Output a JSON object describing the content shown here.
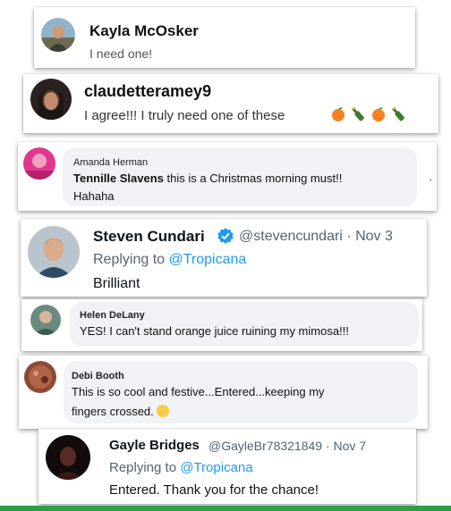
{
  "comments": [
    {
      "name": "Kayla McOsker",
      "text": "I need one!"
    },
    {
      "name": "claudetteramey9",
      "text": "I agree!!! I truly need one of these",
      "emoji": [
        "orange-icon",
        "bottle-icon",
        "orange-icon",
        "bottle-icon"
      ]
    },
    {
      "name": "Amanda Herman",
      "mention": "Tennille Slavens",
      "text": " this is a Christmas morning must!!",
      "text2": "Hahaha",
      "side_glyph": "·"
    },
    {
      "name": "Steven Cundari",
      "handle": "@stevencundari",
      "separator": "·",
      "date": "Nov 3",
      "replying_prefix": "Replying to",
      "replying_to": "@Tropicana",
      "text": "Brilliant"
    },
    {
      "name": "Helen DeLany",
      "text": "YES! I can't stand orange juice ruining my mimosa!!!"
    },
    {
      "name": "Debi Booth",
      "text": "This is so cool and festive...Entered...keeping my",
      "text2": "fingers crossed.",
      "emoji": "😀"
    },
    {
      "name": "Gayle Bridges",
      "handle": "@GayleBr78321849",
      "separator": "·",
      "date": "Nov 7",
      "replying_prefix": "Replying to",
      "replying_to": "@Tropicana",
      "text": "Entered. Thank you for the chance!"
    }
  ],
  "colors": {
    "twitter_blue": "#1d9bf0",
    "bubble_gray": "#f0f2f5",
    "bottom_bar": "#2f9e4a"
  }
}
